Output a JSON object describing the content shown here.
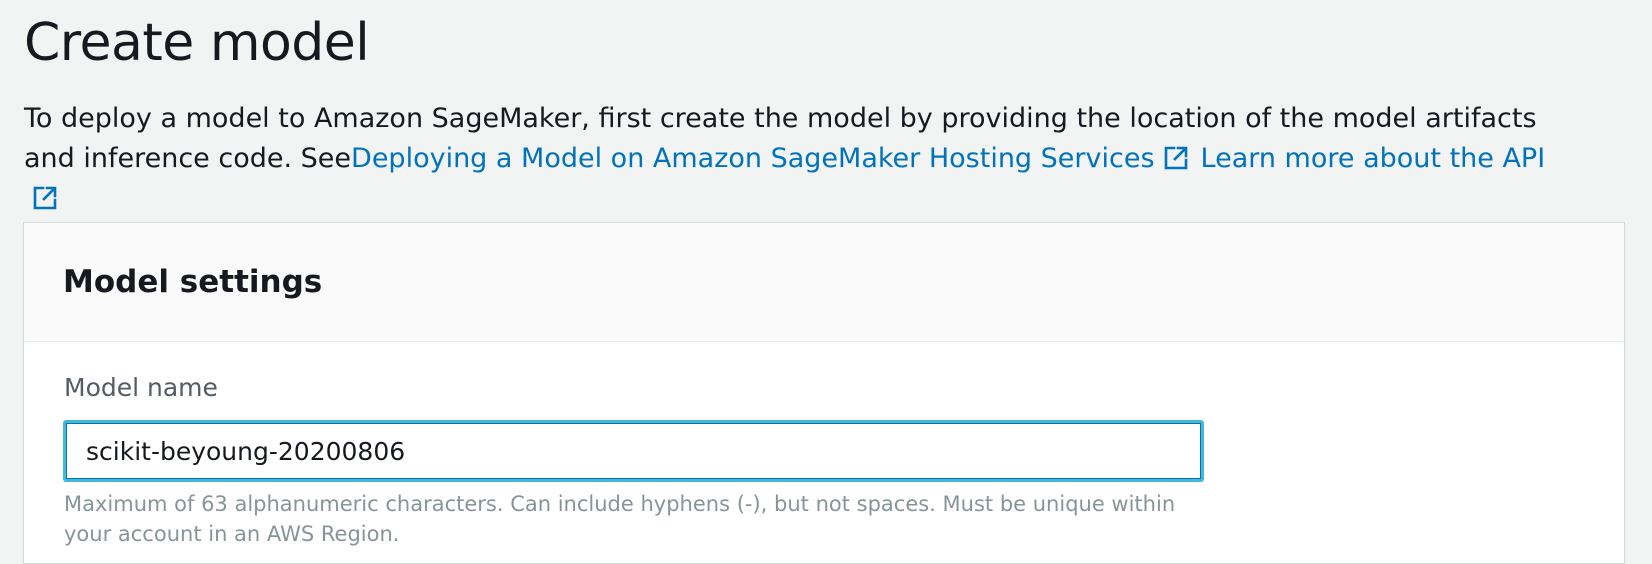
{
  "page": {
    "title": "Create model",
    "intro_text": "To deploy a model to Amazon SageMaker, first create the model by providing the location of the model artifacts and inference code.  See",
    "links": [
      {
        "label": "Deploying a Model on Amazon SageMaker Hosting Services",
        "icon": "external-link-icon"
      },
      {
        "label": "Learn more about the API",
        "icon": "external-link-icon"
      }
    ]
  },
  "model_settings": {
    "title": "Model settings",
    "model_name": {
      "label": "Model name",
      "value": "scikit-beyoung-20200806",
      "hint": "Maximum of 63 alphanumeric characters. Can include hyphens (-), but not spaces. Must be unique within your account in an AWS Region."
    }
  },
  "colors": {
    "link": "#0073bb",
    "focus_border": "#44b9d6",
    "background": "#f2f3f3",
    "hint_text": "#879596"
  }
}
